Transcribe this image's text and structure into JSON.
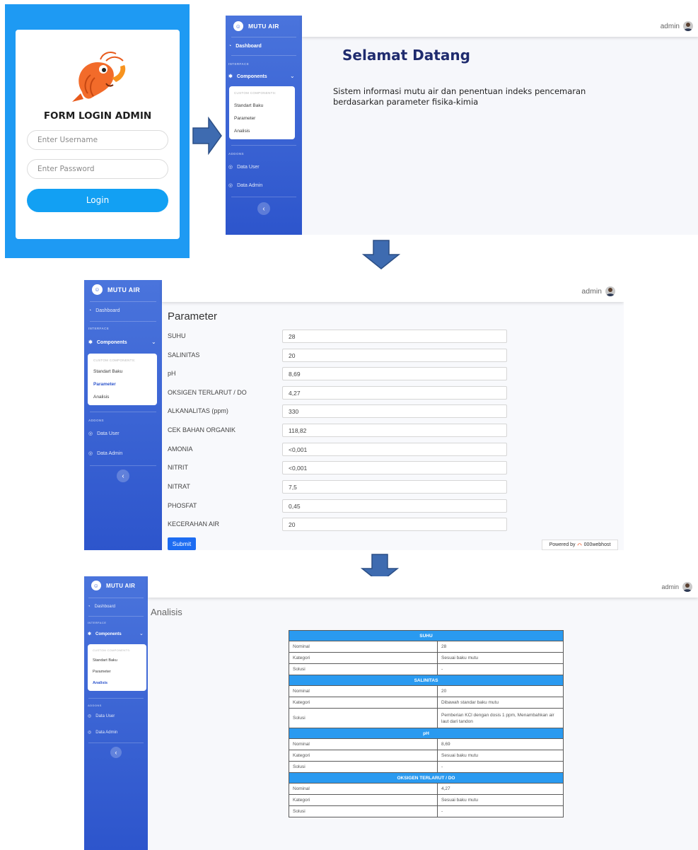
{
  "brand": {
    "name": "MUTU AIR",
    "icon": "smile-logo-icon"
  },
  "user": {
    "name": "admin",
    "icon": "user-avatar-icon"
  },
  "login": {
    "title": "FORM LOGIN ADMIN",
    "username_placeholder": "Enter Username",
    "password_placeholder": "Enter Password",
    "login_label": "Login"
  },
  "sidebar": {
    "dashboard_label": "Dashboard",
    "interface_heading": "INTERFACE",
    "components_label": "Components",
    "custom_heading": "CUSTOM COMPONENTS:",
    "standart_label": "Standart Baku",
    "parameter_label": "Parameter",
    "analisis_label": "Analisis",
    "addons_heading": "ADDONS",
    "data_user_label": "Data User",
    "data_admin_label": "Data Admin",
    "toggle_glyph": "‹"
  },
  "dashboard": {
    "welcome": "Selamat Datang",
    "description": "Sistem informasi mutu air dan penentuan indeks pencemaran berdasarkan parameter fisika-kimia"
  },
  "parameter": {
    "title": "Parameter",
    "fields": [
      {
        "label": "SUHU",
        "value": "28"
      },
      {
        "label": "SALINITAS",
        "value": "20"
      },
      {
        "label": "pH",
        "value": "8,69"
      },
      {
        "label": "OKSIGEN TERLARUT / DO",
        "value": "4,27"
      },
      {
        "label": "ALKANALITAS (ppm)",
        "value": "330"
      },
      {
        "label": "CEK BAHAN ORGANIK",
        "value": "118,82"
      },
      {
        "label": "AMONIA",
        "value": "<0,001"
      },
      {
        "label": "NITRIT",
        "value": "<0,001"
      },
      {
        "label": "NITRAT",
        "value": "7,5"
      },
      {
        "label": "PHOSFAT",
        "value": "0,45"
      },
      {
        "label": "KECERAHAN AIR",
        "value": "20"
      }
    ],
    "submit_label": "Submit",
    "powered_prefix": "Powered by",
    "powered_brand": "000webhost"
  },
  "analisis": {
    "title": "Analisis",
    "sections": [
      {
        "header": "SUHU",
        "rows": [
          {
            "key": "Nominal",
            "value": "28"
          },
          {
            "key": "Kategori",
            "value": "Sesuai baku mutu"
          },
          {
            "key": "Solusi",
            "value": "-"
          }
        ]
      },
      {
        "header": "SALINITAS",
        "rows": [
          {
            "key": "Nominal",
            "value": "20"
          },
          {
            "key": "Kategori",
            "value": "Dibawah standar baku mutu"
          },
          {
            "key": "Solusi",
            "value": "Pemberian KCl dengan dosis 1 ppm, Menambahkan air laut dari tandon"
          }
        ]
      },
      {
        "header": "pH",
        "rows": [
          {
            "key": "Nominal",
            "value": "8,69"
          },
          {
            "key": "Kategori",
            "value": "Sesuai baku mutu"
          },
          {
            "key": "Solusi",
            "value": "-"
          }
        ]
      },
      {
        "header": "OKSIGEN TERLARUT / DO",
        "rows": [
          {
            "key": "Nominal",
            "value": "4,27"
          },
          {
            "key": "Kategori",
            "value": "Sesuai baku mutu"
          },
          {
            "key": "Solusi",
            "value": "-"
          }
        ]
      }
    ]
  },
  "colors": {
    "login_bg": "#1e9af3",
    "sidebar_top": "#4a74dc",
    "sidebar_bottom": "#2d55cc",
    "arrow": "#3e6bb0",
    "table_header": "#2a9af0",
    "submit": "#1d6cf2"
  }
}
